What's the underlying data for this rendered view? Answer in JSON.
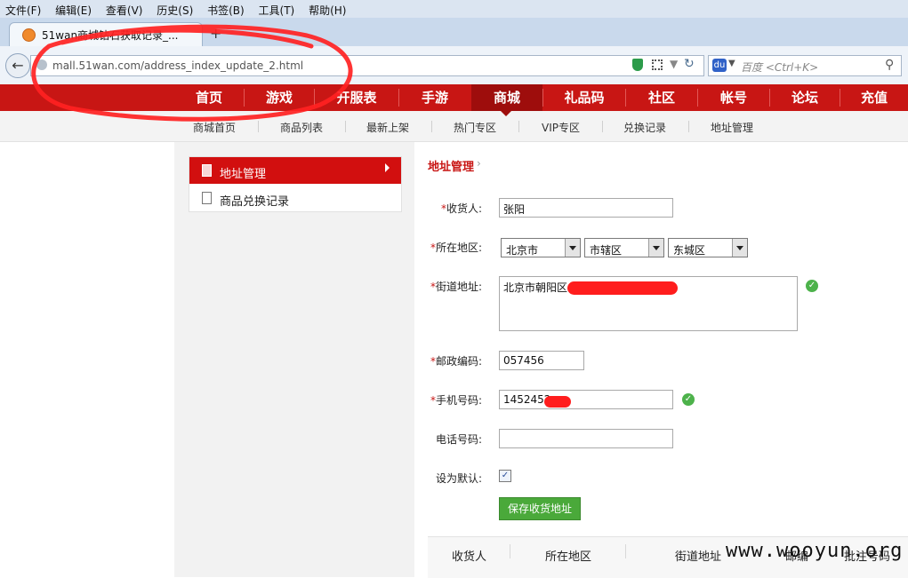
{
  "browser": {
    "menu": [
      "文件(F)",
      "编辑(E)",
      "查看(V)",
      "历史(S)",
      "书签(B)",
      "工具(T)",
      "帮助(H)"
    ],
    "tab_title": "51wan商城钻石获取记录_...",
    "new_tab": "+",
    "url": "mall.51wan.com/address_index_update_2.html",
    "search_placeholder": "百度 <Ctrl+K>"
  },
  "site_nav": {
    "items": [
      "首页",
      "游戏",
      "开服表",
      "手游",
      "商城",
      "礼品码",
      "社区",
      "帐号",
      "论坛",
      "充值"
    ],
    "active": "商城"
  },
  "sub_nav": [
    "商城首页",
    "商品列表",
    "最新上架",
    "热门专区",
    "VIP专区",
    "兑换记录",
    "地址管理"
  ],
  "sidebar": {
    "items": [
      {
        "label": "地址管理",
        "active": true
      },
      {
        "label": "商品兑换记录",
        "active": false
      }
    ]
  },
  "form": {
    "breadcrumb": "地址管理",
    "recipient_label": "收货人:",
    "recipient_value": "张阳",
    "region_label": "所在地区:",
    "province": "北京市",
    "city": "市辖区",
    "district": "东城区",
    "street_label": "街道地址:",
    "street_value": "北京市朝阳区",
    "postcode_label": "邮政编码:",
    "postcode_value": "057456",
    "mobile_label": "手机号码:",
    "mobile_value": "1452452",
    "phone_label": "电话号码:",
    "phone_value": "",
    "default_label": "设为默认:",
    "default_checked": true,
    "save_button": "保存收货地址"
  },
  "table": {
    "headers": [
      "收货人",
      "所在地区",
      "街道地址",
      "邮编",
      "批注号码"
    ]
  },
  "watermark": "www.wooyun.org",
  "colors": {
    "brand_red": "#c81614",
    "active_red": "#9e0d0c",
    "annotation_red": "#ff2222",
    "save_green": "#4aa93a"
  }
}
